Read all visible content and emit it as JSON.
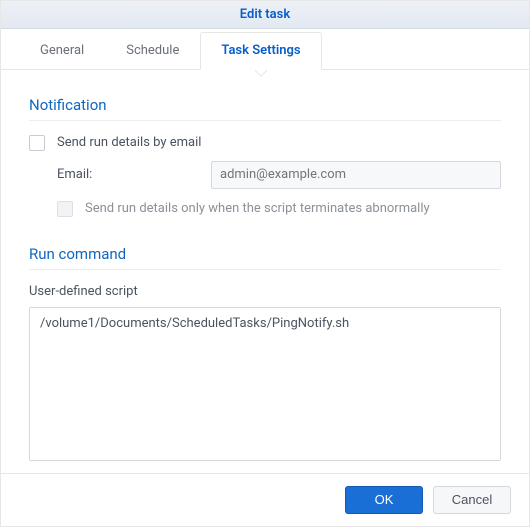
{
  "header": {
    "title": "Edit task"
  },
  "tabs": [
    {
      "label": "General"
    },
    {
      "label": "Schedule"
    },
    {
      "label": "Task Settings"
    }
  ],
  "notification": {
    "heading": "Notification",
    "send_details_label": "Send run details by email",
    "email_label": "Email:",
    "email_placeholder": "admin@example.com",
    "only_abnormal_label": "Send run details only when the script terminates abnormally"
  },
  "run_command": {
    "heading": "Run command",
    "script_label": "User-defined script",
    "script_value": "/volume1/Documents/ScheduledTasks/PingNotify.sh"
  },
  "footer": {
    "ok": "OK",
    "cancel": "Cancel"
  }
}
